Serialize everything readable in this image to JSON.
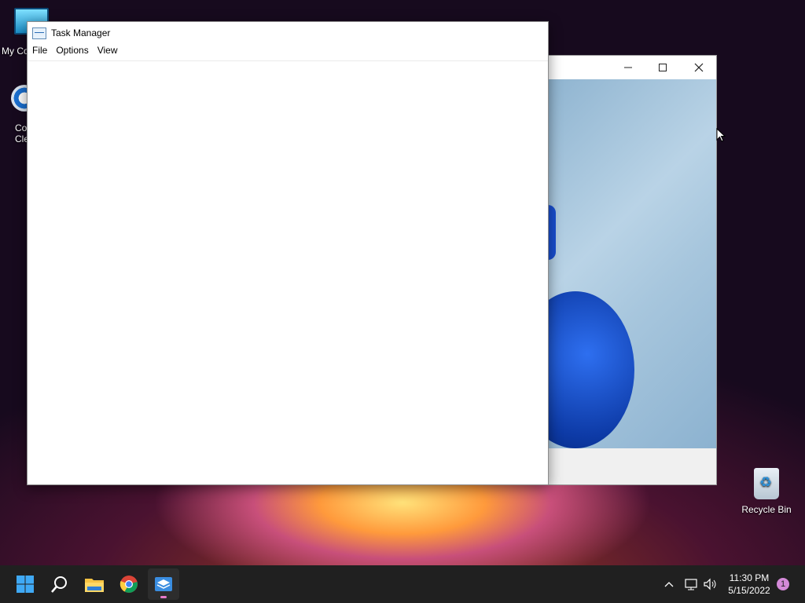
{
  "desktop": {
    "icons": {
      "my_computer": "My Co",
      "ccleaner_line1": "Co",
      "ccleaner_line2": "Cle",
      "recycle_bin": "Recycle Bin"
    }
  },
  "task_manager": {
    "title": "Task Manager",
    "menu": [
      "File",
      "Options",
      "View"
    ]
  },
  "background_window": {
    "controls": [
      "minimize",
      "maximize",
      "close"
    ]
  },
  "taskbar": {
    "apps": [
      "start-icon",
      "search-icon",
      "file-explorer-icon",
      "chrome-icon",
      "task-manager-icon"
    ],
    "clock": {
      "time": "11:30 PM",
      "date": "5/15/2022"
    },
    "notification_count": "1"
  }
}
